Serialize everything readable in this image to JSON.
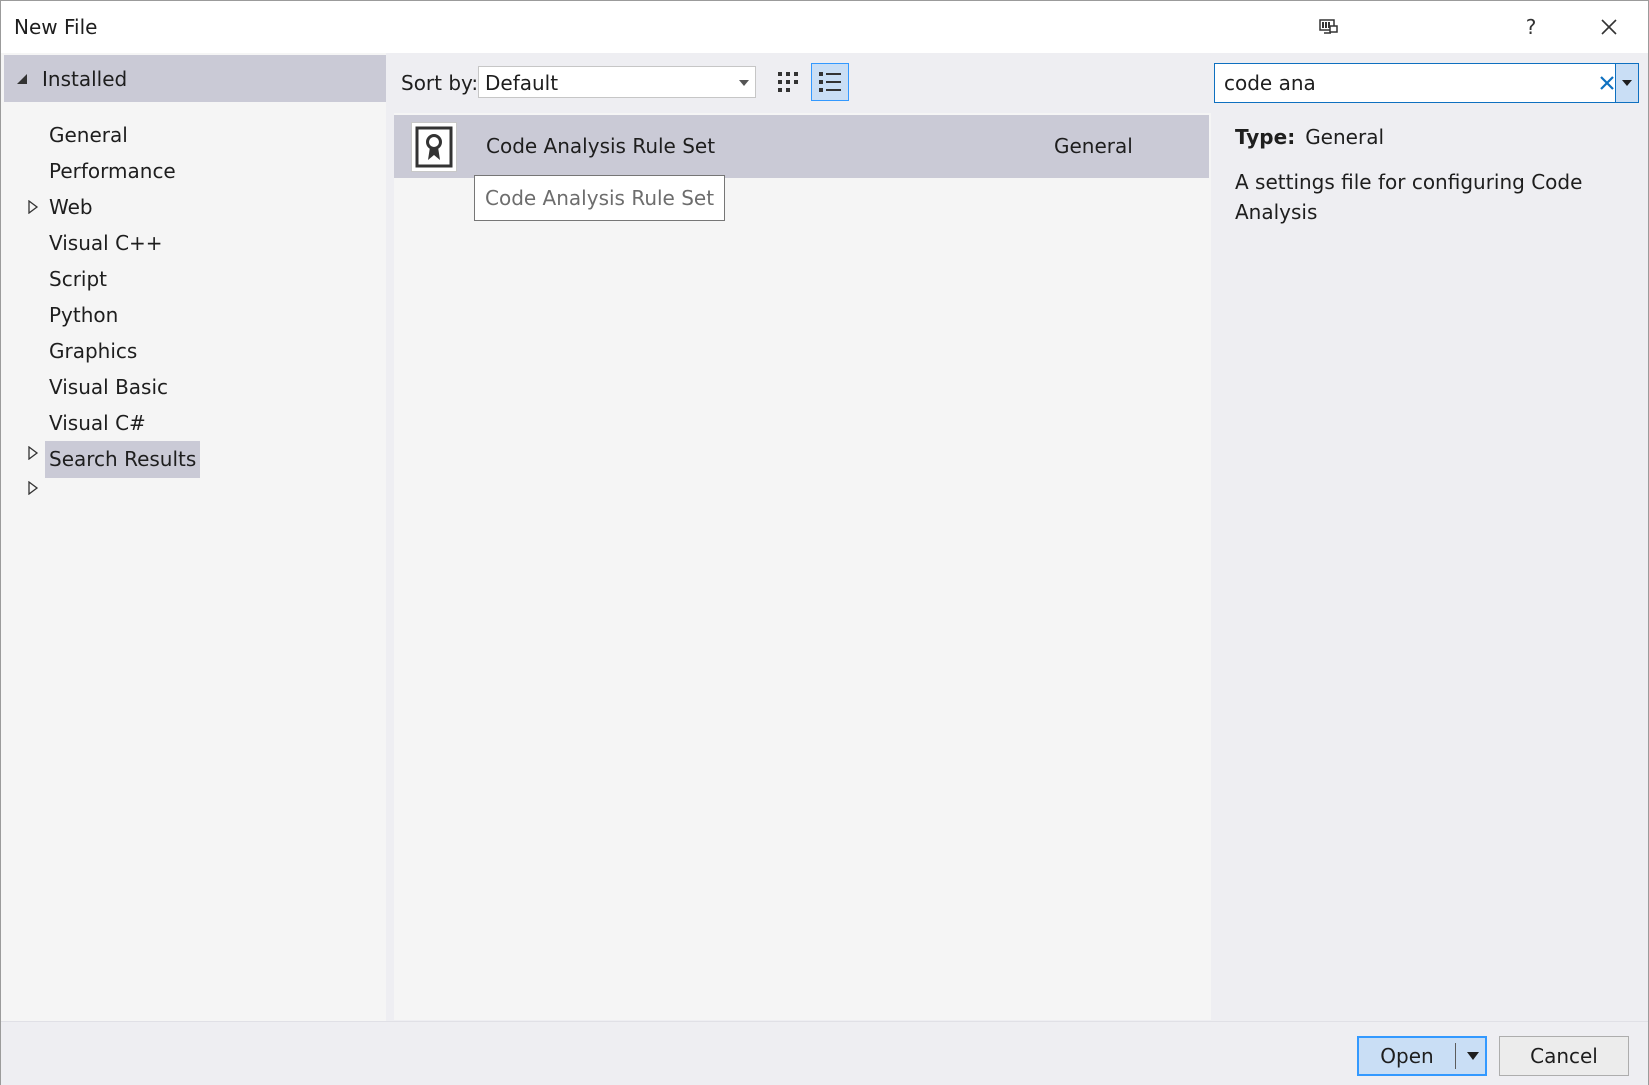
{
  "window": {
    "title": "New File",
    "help_label": "?"
  },
  "sidebar": {
    "installed_label": "Installed",
    "items": [
      {
        "label": "General",
        "expandable": false,
        "selected": false
      },
      {
        "label": "Performance",
        "expandable": false,
        "selected": false
      },
      {
        "label": "Web",
        "expandable": true,
        "selected": false
      },
      {
        "label": "Visual C++",
        "expandable": false,
        "selected": false
      },
      {
        "label": "Script",
        "expandable": false,
        "selected": false
      },
      {
        "label": "Python",
        "expandable": false,
        "selected": false
      },
      {
        "label": "Graphics",
        "expandable": false,
        "selected": false
      },
      {
        "label": "Visual Basic",
        "expandable": true,
        "selected": false
      },
      {
        "label": "Visual C#",
        "expandable": true,
        "selected": false
      },
      {
        "label": "Search Results",
        "expandable": false,
        "selected": true
      }
    ]
  },
  "toolbar": {
    "sort_label": "Sort by:",
    "sort_value": "Default",
    "active_view": "list"
  },
  "search": {
    "value": "code ana"
  },
  "results": [
    {
      "name": "Code Analysis Rule Set",
      "category": "General",
      "icon": "ribbon-award-icon",
      "selected": true
    }
  ],
  "tooltip": "Code Analysis Rule Set",
  "details": {
    "type_key": "Type:",
    "type_value": "General",
    "description": "A settings file for configuring Code Analysis"
  },
  "footer": {
    "open_label": "Open",
    "cancel_label": "Cancel"
  },
  "colors": {
    "selection": "#cacad6",
    "accent": "#3399ff",
    "accent_fill": "#c9def5",
    "focus_border": "#0e70c0"
  }
}
